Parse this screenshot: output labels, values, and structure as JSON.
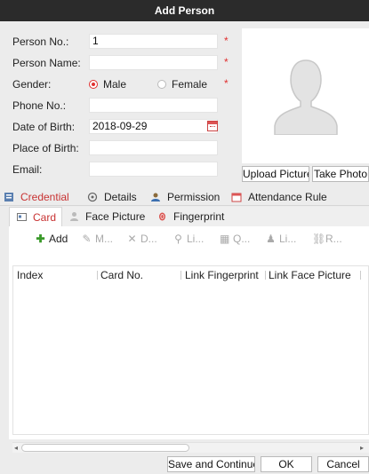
{
  "window": {
    "title": "Add Person"
  },
  "form": {
    "person_no": {
      "label": "Person No.:",
      "value": "1",
      "required": "*"
    },
    "person_name": {
      "label": "Person Name:",
      "value": "",
      "required": "*"
    },
    "gender": {
      "label": "Gender:",
      "options": [
        "Male",
        "Female"
      ],
      "selected": "Male",
      "required": "*"
    },
    "phone_no": {
      "label": "Phone No.:",
      "value": ""
    },
    "date_of_birth": {
      "label": "Date of Birth:",
      "value": "2018-09-29"
    },
    "place_of_birth": {
      "label": "Place of Birth:",
      "value": ""
    },
    "email": {
      "label": "Email:",
      "value": ""
    }
  },
  "photo": {
    "upload_label": "Upload Picture",
    "take_label": "Take Photo"
  },
  "main_tabs": [
    {
      "label": "Credential",
      "active": true,
      "icon": "credential-icon"
    },
    {
      "label": "Details",
      "active": false,
      "icon": "details-icon"
    },
    {
      "label": "Permission",
      "active": false,
      "icon": "permission-icon"
    },
    {
      "label": "Attendance Rule",
      "active": false,
      "icon": "attendance-icon"
    }
  ],
  "sub_tabs": [
    {
      "label": "Card",
      "active": true,
      "icon": "card-icon"
    },
    {
      "label": "Face Picture",
      "active": false,
      "icon": "face-icon"
    },
    {
      "label": "Fingerprint",
      "active": false,
      "icon": "fingerprint-icon"
    }
  ],
  "toolbar": [
    {
      "label": "Add",
      "icon": "plus-icon",
      "enabled": true
    },
    {
      "label": "M...",
      "icon": "edit-icon",
      "enabled": false
    },
    {
      "label": "D...",
      "icon": "delete-icon",
      "enabled": false
    },
    {
      "label": "Li...",
      "icon": "link-icon",
      "enabled": false
    },
    {
      "label": "Q...",
      "icon": "query-icon",
      "enabled": false
    },
    {
      "label": "Li...",
      "icon": "link-person-icon",
      "enabled": false
    },
    {
      "label": "R...",
      "icon": "unlink-icon",
      "enabled": false
    }
  ],
  "table": {
    "columns": [
      "Index",
      "Card No.",
      "Link Fingerprint",
      "Link Face Picture"
    ],
    "rows": []
  },
  "footer": {
    "save_continue_label": "Save and Continue",
    "ok_label": "OK",
    "cancel_label": "Cancel"
  },
  "colors": {
    "accent": "#c83232",
    "required": "#e03030",
    "titlebar": "#2b2b2b"
  }
}
